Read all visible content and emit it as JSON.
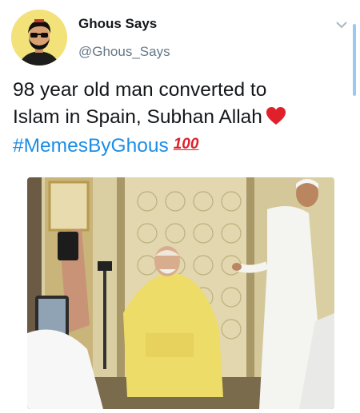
{
  "tweet": {
    "author": {
      "display_name": "Ghous Says",
      "handle": "@Ghous_Says"
    },
    "text_lines": [
      "98 year old man converted to",
      "Islam in Spain, Subhan Allah"
    ],
    "hashtag": "#MemesByGhous",
    "hundred_emoji": "100",
    "icons": [
      "chevron-down-icon",
      "heart-icon",
      "hundred-points-icon"
    ],
    "colors": {
      "hashtag": "#1b8ee6",
      "heart": "#e0202a",
      "handle": "#657786",
      "avatar_background": "#f3e27a"
    }
  }
}
